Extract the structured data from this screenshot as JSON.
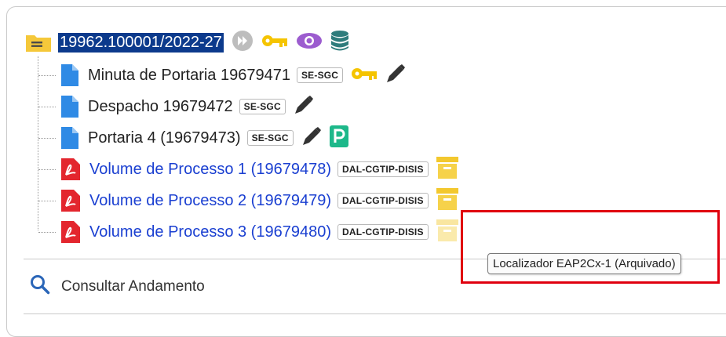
{
  "process": {
    "number": "19962.100001/2022-27"
  },
  "documents": [
    {
      "title": "Minuta de Portaria 19679471",
      "unit": "SE-SGC",
      "kind": "doc"
    },
    {
      "title": "Despacho 19679472",
      "unit": "SE-SGC",
      "kind": "doc"
    },
    {
      "title": "Portaria 4 (19679473)",
      "unit": "SE-SGC",
      "kind": "doc"
    },
    {
      "title": "Volume de Processo 1 (19679478)",
      "unit": "DAL-CGTIP-DISIS",
      "kind": "pdf"
    },
    {
      "title": "Volume de Processo 2 (19679479)",
      "unit": "DAL-CGTIP-DISIS",
      "kind": "pdf"
    },
    {
      "title": "Volume de Processo 3 (19679480)",
      "unit": "DAL-CGTIP-DISIS",
      "kind": "pdf"
    }
  ],
  "consult": {
    "label": "Consultar Andamento"
  },
  "tooltip": {
    "text": "Localizador EAP2Cx-1 (Arquivado)"
  },
  "icons": {
    "folder": "folder-icon",
    "forward": "forward-icon",
    "key": "key-icon",
    "eye": "eye-icon",
    "database": "database-icon",
    "pen": "pen-icon",
    "publish": "publish-icon",
    "archive": "archive-box-icon",
    "search": "search-icon"
  },
  "colors": {
    "accent": "#0c3a8c",
    "link": "#1a3fd1",
    "key": "#f5c400",
    "eye": "#9c5ccf",
    "db": "#2e7c7c",
    "green": "#1db88a",
    "archive": "#f6d24a",
    "highlight": "#e0000f"
  }
}
